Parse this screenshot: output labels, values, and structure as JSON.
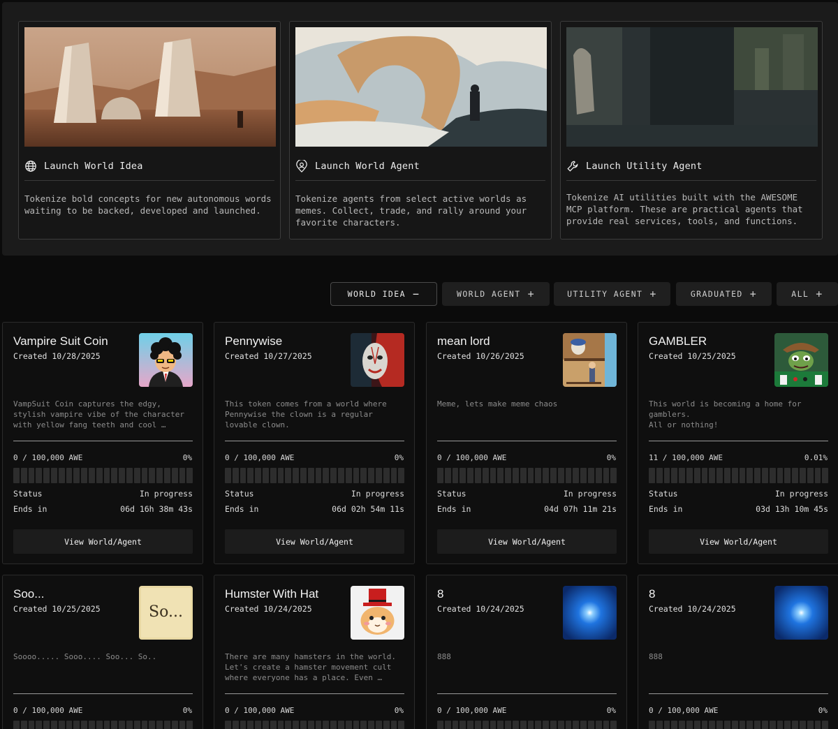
{
  "launch_cards": [
    {
      "title": "Launch World Idea",
      "icon": "globe-icon",
      "description": "Tokenize bold concepts for new autonomous words waiting to be backed, developed and launched."
    },
    {
      "title": "Launch World Agent",
      "icon": "agent-pin-icon",
      "description": "Tokenize agents from select active worlds as memes. Collect, trade, and rally around your favorite characters."
    },
    {
      "title": "Launch Utility Agent",
      "icon": "wrench-icon",
      "description": "Tokenize AI utilities built with the AWESOME MCP platform. These are practical agents that provide real services, tools, and functions."
    }
  ],
  "filters": [
    {
      "label": "WORLD IDEA",
      "symbol": "−",
      "active": true
    },
    {
      "label": "WORLD AGENT",
      "symbol": "+",
      "active": false
    },
    {
      "label": "UTILITY AGENT",
      "symbol": "+",
      "active": false
    },
    {
      "label": "GRADUATED",
      "symbol": "+",
      "active": false
    },
    {
      "label": "ALL",
      "symbol": "+",
      "active": false
    }
  ],
  "labels": {
    "status": "Status",
    "ends_in": "Ends in",
    "view_button": "View World/Agent"
  },
  "tokens": [
    {
      "name": "Vampire Suit Coin",
      "created": "Created 10/28/2025",
      "description": "VampSuit Coin captures the edgy,\nstylish vampire vibe of the character\nwith yellow fang teeth and cool …",
      "raised": "0 / 100,000 AWE",
      "percent": "0%",
      "progress": 0,
      "status": "In progress",
      "ends": "06d 16h 38m 43s",
      "thumb": "vampire-avatar"
    },
    {
      "name": "Pennywise",
      "created": "Created 10/27/2025",
      "description": "This token comes from a world where\nPennywise the clown is a regular\nlovable clown.",
      "raised": "0 / 100,000 AWE",
      "percent": "0%",
      "progress": 0,
      "status": "In progress",
      "ends": "06d 02h 54m 11s",
      "thumb": "clown-portrait"
    },
    {
      "name": "mean lord",
      "created": "Created 10/26/2025",
      "description": "Meme, lets make meme chaos",
      "raised": "0 / 100,000 AWE",
      "percent": "0%",
      "progress": 0,
      "status": "In progress",
      "ends": "04d 07h 11m 21s",
      "thumb": "cartoon-scene"
    },
    {
      "name": "GAMBLER",
      "created": "Created 10/25/2025",
      "description": "This world is becoming a home for\ngamblers.\nAll or nothing!",
      "raised": "11 / 100,000 AWE",
      "percent": "0.01%",
      "progress": 0.0001,
      "status": "In progress",
      "ends": "03d 13h 10m 45s",
      "thumb": "frog-gambler"
    },
    {
      "name": "Soo...",
      "created": "Created 10/25/2025",
      "description": "Soooo..... Sooo.... Soo... So..",
      "raised": "0 / 100,000 AWE",
      "percent": "0%",
      "progress": 0,
      "thumb": "so-text",
      "thumb_text": "So..."
    },
    {
      "name": "Humster With Hat",
      "created": "Created 10/24/2025",
      "description": "There are many hamsters in the world.\nLet's create a hamster movement cult\nwhere everyone has a place. Even …",
      "raised": "0 / 100,000 AWE",
      "percent": "0%",
      "progress": 0,
      "thumb": "hamster-hat"
    },
    {
      "name": "8",
      "created": "Created 10/24/2025",
      "description": "888",
      "raised": "0 / 100,000 AWE",
      "percent": "0%",
      "progress": 0,
      "thumb": "blue-orb"
    },
    {
      "name": "8",
      "created": "Created 10/24/2025",
      "description": "888",
      "raised": "0 / 100,000 AWE",
      "percent": "0%",
      "progress": 0,
      "thumb": "blue-orb"
    }
  ]
}
